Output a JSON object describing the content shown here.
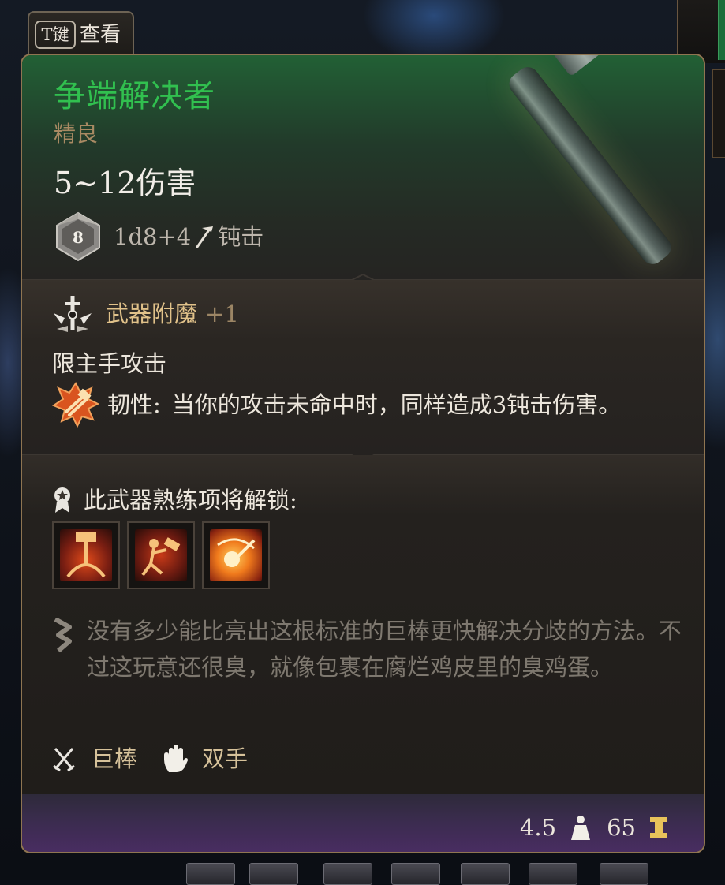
{
  "hotkey": {
    "key": "T键",
    "label": "查看"
  },
  "item": {
    "name": "争端解决者",
    "rarity": "精良",
    "damage": "5~12伤害",
    "dice_label": "8",
    "dice_roll": "1d8+4",
    "damage_type": "钝击",
    "name_color": "#31c04f"
  },
  "enchantment": {
    "name": "武器附魔",
    "bonus": "+1",
    "main_hand_only": "限主手攻击",
    "property_name": "韧性:",
    "property_desc": "当你的攻击未命中时，同样造成3钝击伤害。"
  },
  "proficiency": {
    "label": "此武器熟练项将解锁:",
    "actions": [
      {
        "icon": "overhead-smash-icon"
      },
      {
        "icon": "tenacity-strike-icon"
      },
      {
        "icon": "concussive-blow-icon"
      }
    ]
  },
  "flavor": {
    "text": "没有多少能比亮出这根标准的巨棒更快解决分歧的方法。不过这玩意还很臭，就像包裹在腐烂鸡皮里的臭鸡蛋。"
  },
  "properties": [
    {
      "icon": "crossed-swords-icon",
      "label": "巨棒"
    },
    {
      "icon": "hand-icon",
      "label": "双手"
    }
  ],
  "footer": {
    "weight": "4.5",
    "value": "65"
  }
}
